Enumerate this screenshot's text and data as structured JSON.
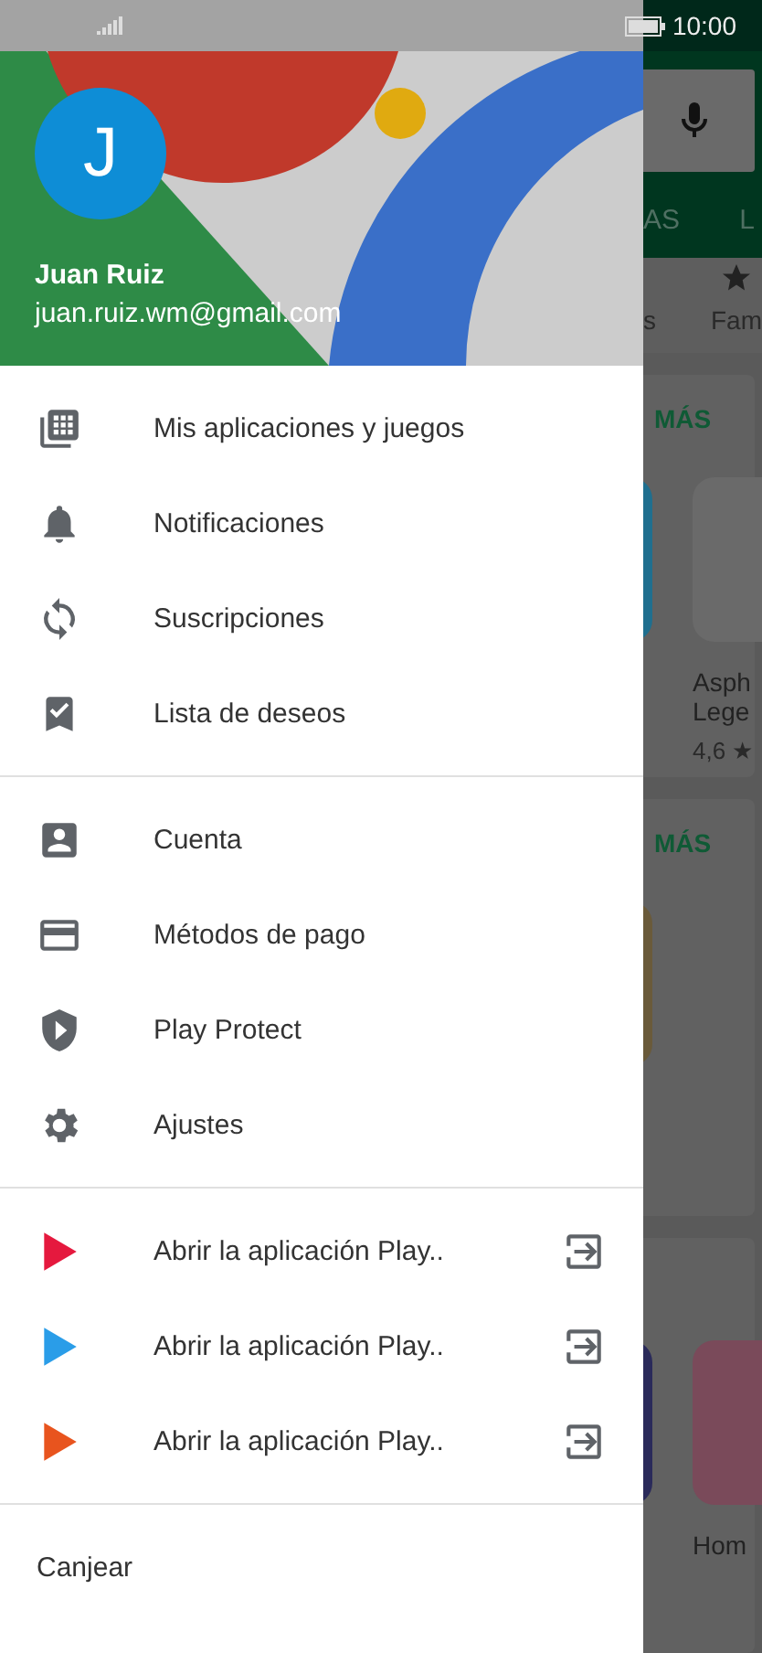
{
  "status_bar": {
    "time": "10:00"
  },
  "background": {
    "tabs": [
      "AS",
      "L"
    ],
    "chips": [
      "s",
      "Fam"
    ],
    "cards": [
      {
        "more": "MÁS",
        "apps": [
          {
            "color": "#1f6f8f"
          },
          {
            "color": "#6a6a6a",
            "title": [
              "Asph",
              "Lege"
            ],
            "rating": "4,6 ★"
          }
        ]
      },
      {
        "more": "MÁS",
        "apps": [
          {
            "color": "#6a5a3a"
          }
        ]
      },
      {
        "apps": [
          {
            "color": "#2a2a5a"
          },
          {
            "color": "#7a4a5a",
            "title": [
              "Hom"
            ]
          }
        ]
      }
    ]
  },
  "account": {
    "initial": "J",
    "name": "Juan Ruiz",
    "email": "juan.ruiz.wm@gmail.com"
  },
  "menu_sections": [
    {
      "items": [
        {
          "kind": "apps",
          "label": "Mis aplicaciones y juegos"
        },
        {
          "kind": "bell",
          "label": "Notificaciones"
        },
        {
          "kind": "sync",
          "label": "Suscripciones"
        },
        {
          "kind": "bookmark",
          "label": "Lista de deseos"
        }
      ]
    },
    {
      "items": [
        {
          "kind": "account",
          "label": "Cuenta"
        },
        {
          "kind": "card",
          "label": "Métodos de pago"
        },
        {
          "kind": "shield",
          "label": "Play Protect"
        },
        {
          "kind": "gear",
          "label": "Ajustes"
        }
      ]
    },
    {
      "items": [
        {
          "kind": "movies",
          "label": "Abrir la aplicación Play.."
        },
        {
          "kind": "books",
          "label": "Abrir la aplicación Play.."
        },
        {
          "kind": "music",
          "label": "Abrir la aplicación Play.."
        }
      ]
    }
  ],
  "footer_item": {
    "label": "Canjear"
  }
}
